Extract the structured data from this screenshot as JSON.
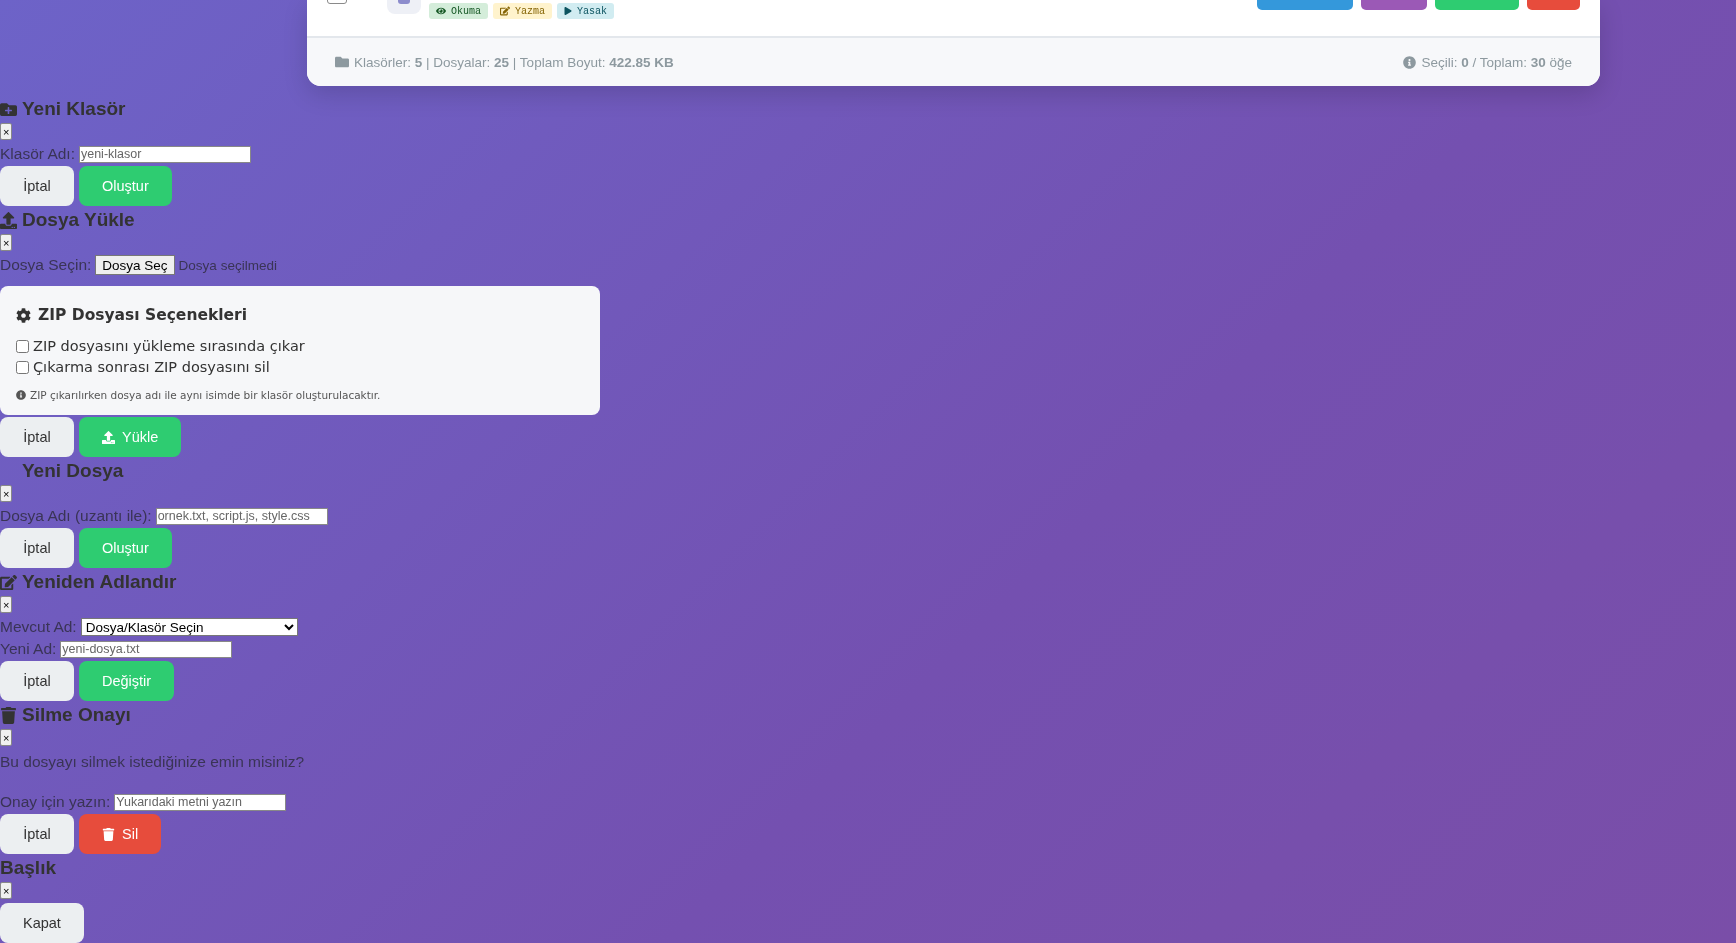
{
  "file_card": {
    "row": {
      "checked": false,
      "tags": [
        {
          "kind": "read",
          "label": "Okuma"
        },
        {
          "kind": "write",
          "label": "Yazma"
        },
        {
          "kind": "exec",
          "label": "Yasak"
        }
      ],
      "actions": [
        {
          "color": "#3498db"
        },
        {
          "color": "#9b59b6"
        },
        {
          "color": "#2ecc71"
        },
        {
          "color": "#e74c3c"
        }
      ]
    },
    "footer": {
      "summary": "Klasörler: **5** | Dosyalar: **25** | Toplam Boyut: **422.85 KB**",
      "selection": "Seçili: **0** / Toplam: **30** öğe"
    }
  },
  "dialogs": [
    {
      "kind": "new-folder",
      "title": "Yeni Klasör",
      "close": "×",
      "fields": [
        {
          "kind": "input",
          "label": "Klasör Adı:",
          "placeholder": "yeni-klasor"
        }
      ],
      "buttons": [
        {
          "kind": "secondary",
          "label": "İptal"
        },
        {
          "kind": "success",
          "label": "Oluştur"
        }
      ]
    },
    {
      "kind": "upload",
      "title": "Dosya Yükle",
      "close": "×",
      "fields": [
        {
          "kind": "file",
          "label": "Dosya Seçin:",
          "button": "Dosya Seç",
          "status": "Dosya seçilmedi"
        }
      ],
      "options": {
        "title": "ZIP Dosyası Seçenekleri",
        "checks": [
          {
            "label": "ZIP dosyasını yükleme sırasında çıkar",
            "checked": false
          },
          {
            "label": "Çıkarma sonrası ZIP dosyasını sil",
            "checked": false
          }
        ],
        "note": "ZIP çıkarılırken dosya adı ile aynı isimde bir klasör oluşturulacaktır."
      },
      "buttons": [
        {
          "kind": "secondary",
          "label": "İptal"
        },
        {
          "kind": "upload",
          "label": "Yükle"
        }
      ]
    },
    {
      "kind": "new-file",
      "title": "Yeni Dosya",
      "close": "×",
      "fields": [
        {
          "kind": "input",
          "label": "Dosya Adı (uzantı ile):",
          "placeholder": "ornek.txt, script.js, style.css"
        }
      ],
      "buttons": [
        {
          "kind": "secondary",
          "label": "İptal"
        },
        {
          "kind": "success",
          "label": "Oluştur"
        }
      ]
    },
    {
      "kind": "rename",
      "title": "Yeniden Adlandır",
      "close": "×",
      "fields": [
        {
          "kind": "select",
          "label": "Mevcut Ad:",
          "value": "Dosya/Klasör Seçin"
        },
        {
          "kind": "input",
          "label": "Yeni Ad:",
          "placeholder": "yeni-dosya.txt"
        }
      ],
      "buttons": [
        {
          "kind": "secondary",
          "label": "İptal"
        },
        {
          "kind": "success",
          "label": "Değiştir"
        }
      ]
    },
    {
      "kind": "delete",
      "title": "Silme Onayı",
      "close": "×",
      "fields": [
        {
          "kind": "text",
          "label": "Bu dosyayı silmek istediğinize emin misiniz?"
        },
        {
          "kind": "input",
          "label": "Onay için yazın:",
          "placeholder": "Yukarıdaki metni yazın"
        }
      ],
      "buttons": [
        {
          "kind": "secondary",
          "label": "İptal"
        },
        {
          "kind": "danger",
          "label": "Sil"
        }
      ]
    },
    {
      "kind": "message",
      "title": "Başlık",
      "close": "×",
      "buttons": [
        {
          "kind": "secondary",
          "label": "Kapat"
        }
      ]
    }
  ]
}
